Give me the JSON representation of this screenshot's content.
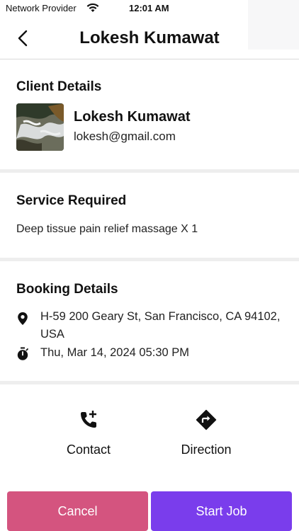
{
  "status_bar": {
    "carrier": "Network Provider",
    "time": "12:01 AM"
  },
  "nav": {
    "title": "Lokesh Kumawat",
    "back_icon": "chevron-left-icon"
  },
  "client_details": {
    "heading": "Client Details",
    "name": "Lokesh Kumawat",
    "email": "lokesh@gmail.com"
  },
  "service": {
    "heading": "Service Required",
    "description": "Deep tissue pain relief massage X 1"
  },
  "booking": {
    "heading": "Booking Details",
    "address": "H-59 200 Geary St, San Francisco, CA 94102, USA",
    "datetime": "Thu, Mar 14, 2024 05:30 PM"
  },
  "actions": {
    "contact_label": "Contact",
    "direction_label": "Direction"
  },
  "buttons": {
    "cancel_label": "Cancel",
    "start_label": "Start Job"
  },
  "colors": {
    "cancel": "#d4547f",
    "start": "#7a3dec"
  }
}
